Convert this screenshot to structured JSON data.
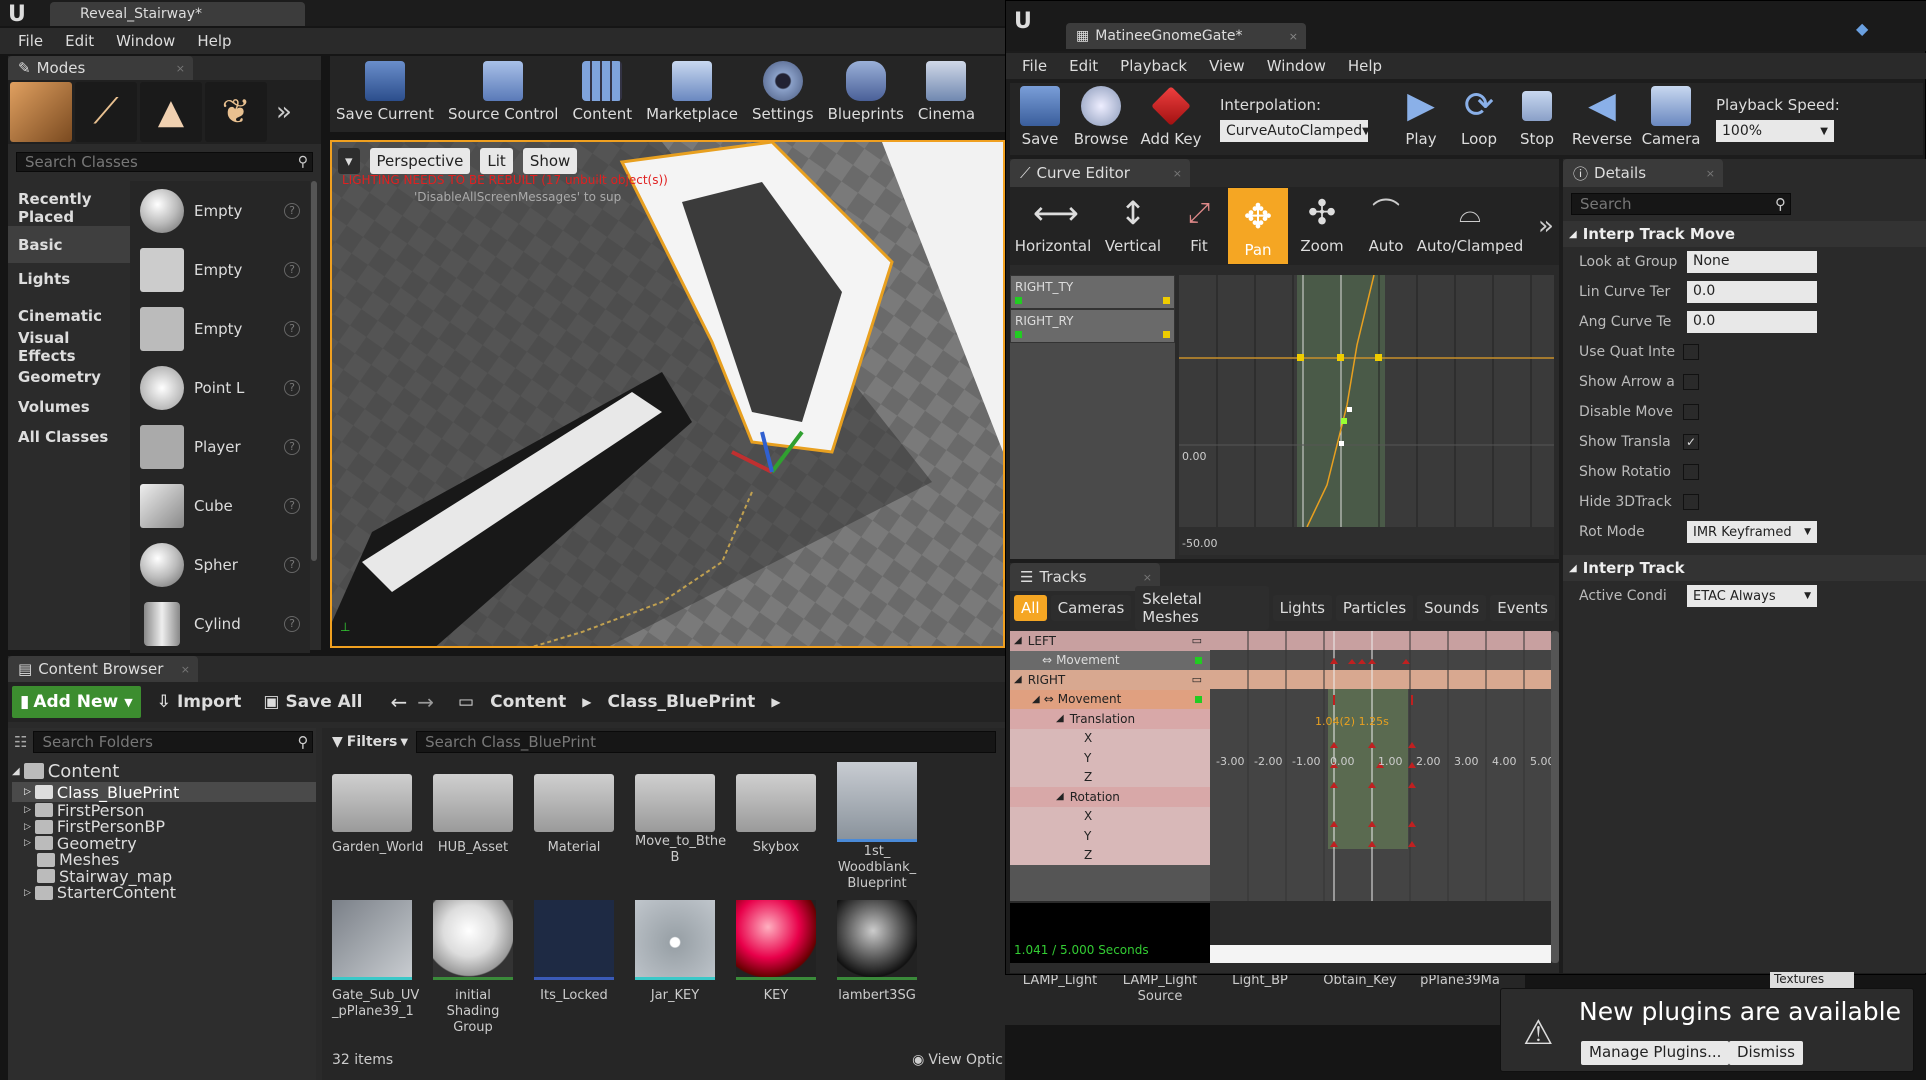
{
  "main": {
    "title": "Reveal_Stairway*",
    "menu": [
      "File",
      "Edit",
      "Window",
      "Help"
    ]
  },
  "modes": {
    "title": "Modes",
    "search_placeholder": "Search Classes",
    "categories": [
      "Recently Placed",
      "Basic",
      "Lights",
      "Cinematic",
      "Visual Effects",
      "Geometry",
      "Volumes",
      "All Classes"
    ],
    "items": [
      "Empty",
      "Empty",
      "Empty",
      "Point L",
      "Player",
      "Cube",
      "Spher",
      "Cylind"
    ]
  },
  "toolbar": {
    "items": [
      "Save Current",
      "Source Control",
      "Content",
      "Marketplace",
      "Settings",
      "Blueprints",
      "Cinema"
    ]
  },
  "viewport": {
    "perspective": "Perspective",
    "lit": "Lit",
    "show": "Show",
    "warning": "LIGHTING NEEDS TO BE REBUILT (17 unbuilt object(s))",
    "sub": "'DisableAllScreenMessages' to sup"
  },
  "cb": {
    "title": "Content Browser",
    "add_new": "Add New",
    "import": "Import",
    "save_all": "Save All",
    "path": [
      "Content",
      "Class_BluePrint"
    ],
    "folder_search": "Search Folders",
    "filters": "Filters",
    "asset_search": "Search Class_BluePrint",
    "tree_root": "Content",
    "tree": [
      "Class_BluePrint",
      "FirstPerson",
      "FirstPersonBP",
      "Geometry",
      "Meshes",
      "Stairway_map",
      "StarterContent"
    ],
    "row1": [
      "Garden_World",
      "HUB_Asset",
      "Material",
      "Move_to_Bthe B",
      "Skybox",
      "1st_ Woodblank_ Blueprint"
    ],
    "row2": [
      "Gate_Sub_UV _pPlane39_1",
      "initial Shading Group",
      "Its_Locked",
      "Jar_KEY",
      "KEY",
      "lambert3SG"
    ],
    "row2b": [
      "LAMP_Light",
      "LAMP_Light Source",
      "Light_BP",
      "Obtain_Key",
      "pPlane39Ma"
    ],
    "count": "32 items",
    "view_options": "View Optic",
    "textures": "Textures"
  },
  "matinee": {
    "title": "MatineeGnomeGate*",
    "menu": [
      "File",
      "Edit",
      "Playback",
      "View",
      "Window",
      "Help"
    ],
    "toolbar": [
      "Save",
      "Browse",
      "Add Key",
      "Play",
      "Loop",
      "Stop",
      "Reverse",
      "Camera"
    ],
    "interp_label": "Interpolation:",
    "interp_value": "CurveAutoClamped",
    "speed_label": "Playback Speed:",
    "speed_value": "100%"
  },
  "curve": {
    "title": "Curve Editor",
    "tools": [
      "Horizontal",
      "Vertical",
      "Fit",
      "Pan",
      "Zoom",
      "Auto",
      "Auto/Clamped"
    ],
    "tracks": [
      "RIGHT_TY",
      "RIGHT_RY"
    ],
    "y_labels": [
      "0.00",
      "-50.00"
    ],
    "x_labels": [
      "-3.00",
      "-2.00",
      "-1.00",
      "0.00",
      "1.00",
      "2.00",
      "3.00",
      "4.00",
      "5.00"
    ]
  },
  "tracks": {
    "title": "Tracks",
    "filters": [
      "All",
      "Cameras",
      "Skeletal Meshes",
      "Lights",
      "Particles",
      "Sounds",
      "Events"
    ],
    "rows": [
      "LEFT",
      "Movement",
      "RIGHT",
      "Movement",
      "Translation",
      "X",
      "Y",
      "Z",
      "Rotation",
      "X",
      "Y",
      "Z"
    ],
    "time": "1.041 / 5.000 Seconds",
    "marker": "1.04(2) 1.25s"
  },
  "details": {
    "title": "Details",
    "search": "Search",
    "section1": "Interp Track Move",
    "props": [
      {
        "label": "Look at Group",
        "value": "None"
      },
      {
        "label": "Lin Curve Ter",
        "value": "0.0"
      },
      {
        "label": "Ang Curve Te",
        "value": "0.0"
      },
      {
        "label": "Use Quat Inte",
        "value": ""
      },
      {
        "label": "Show Arrow a",
        "value": ""
      },
      {
        "label": "Disable Move",
        "value": ""
      },
      {
        "label": "Show Transla",
        "value": ""
      },
      {
        "label": "Show Rotatio",
        "value": ""
      },
      {
        "label": "Hide 3DTrack",
        "value": ""
      },
      {
        "label": "Rot Mode",
        "value": "IMR Keyframed"
      }
    ],
    "section2": "Interp Track",
    "active_label": "Active Condi",
    "active_value": "ETAC Always"
  },
  "notify": {
    "title": "New plugins are available",
    "manage": "Manage Plugins...",
    "dismiss": "Dismiss"
  },
  "colors": {
    "accent": "#f5a623",
    "orange_bar": "#e58a1f",
    "select": "#3e7bd1",
    "add_new": "#3c8d2f"
  }
}
